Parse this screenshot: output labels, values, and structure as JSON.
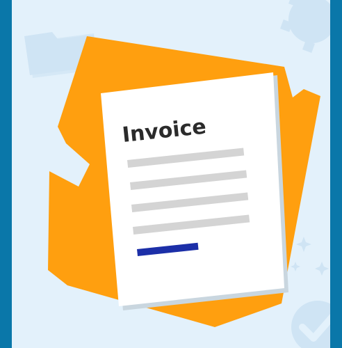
{
  "document": {
    "title": "Invoice"
  },
  "icons": {
    "background_left": "folder-icon",
    "background_top_right": "gear-icon",
    "background_bottom_right": "checkmark-badge-icon",
    "background_sparkles": "sparkle-icon",
    "main": "invoice-document-icon"
  },
  "colors": {
    "border": "#0a77a9",
    "background": "#e3f1fb",
    "background_shapes": "#cfe4f4",
    "orange_sheet": "#ff9f0f",
    "paper": "#ffffff",
    "paper_shadow": "#c9d6df",
    "text_lines": "#d4d4d4",
    "title_text": "#2b2b2b",
    "accent_line": "#1c2fa8"
  }
}
